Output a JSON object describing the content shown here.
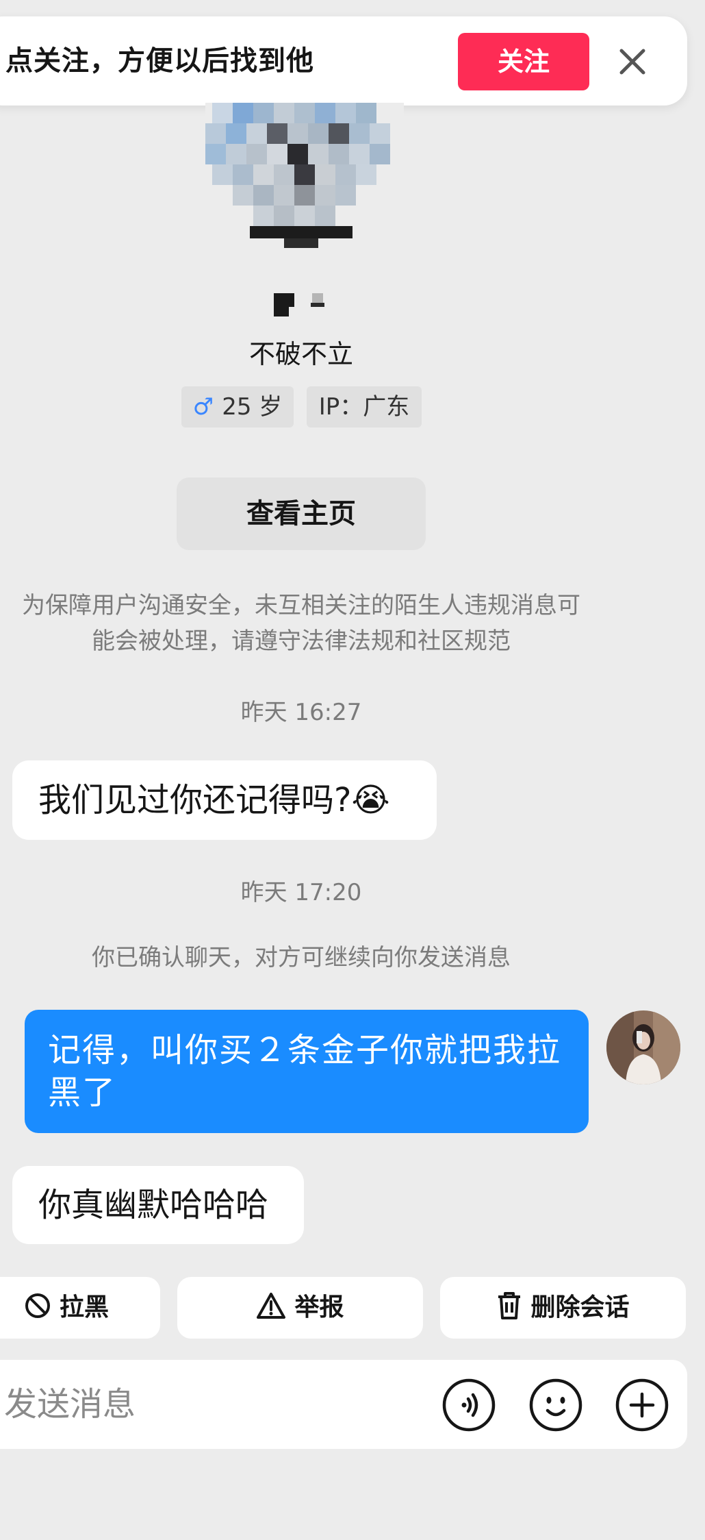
{
  "follow_banner": {
    "text": "点关注，方便以后找到他",
    "follow_label": "关注"
  },
  "profile": {
    "name": "不破不立",
    "gender_icon": "male-icon",
    "gender_symbol": "♂",
    "age": "25 岁",
    "ip": "IP：广东",
    "view_profile_label": "查看主页"
  },
  "chat": {
    "safety_notice_line1": "为保障用户沟通安全，未互相关注的陌生人违规消息可",
    "safety_notice_line2": "能会被处理，请遵守法律法规和社区规范",
    "timestamp_1": "昨天 16:27",
    "message_1": "我们见过你还记得吗?😭",
    "timestamp_2": "昨天 17:20",
    "confirm_notice": "你已确认聊天，对方可继续向你发送消息",
    "message_2": "记得，叫你买２条金子你就把我拉黑了",
    "message_3": "你真幽默哈哈哈"
  },
  "actions": {
    "block_label": "拉黑",
    "report_label": "举报",
    "delete_label": "删除会话"
  },
  "composer": {
    "placeholder": "发送消息"
  },
  "colors": {
    "accent_red": "#fe2c55",
    "bubble_blue": "#1a8cff",
    "background": "#ececec"
  }
}
